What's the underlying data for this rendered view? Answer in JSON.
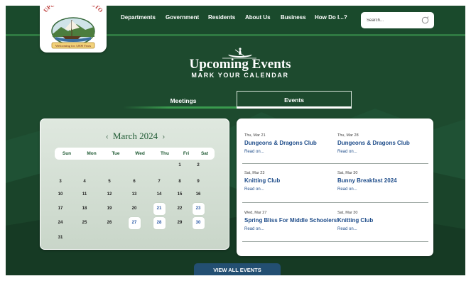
{
  "logo": {
    "name_top": "DUPONT · WASHINGTON",
    "banner": "Welcoming for 3,000 Years"
  },
  "nav": {
    "items": [
      "Departments",
      "Government",
      "Residents",
      "About Us",
      "Business",
      "How Do I...?"
    ]
  },
  "search": {
    "placeholder": "Search..."
  },
  "hero": {
    "title": "Upcoming Events",
    "subtitle": "MARK YOUR CALENDAR"
  },
  "tabs": {
    "meetings": "Meetings",
    "events": "Events",
    "active": "Events"
  },
  "calendar": {
    "month_label": "March 2024",
    "prev": "‹",
    "next": "›",
    "weekdays": [
      "Sun",
      "Mon",
      "Tue",
      "Wed",
      "Thu",
      "Fri",
      "Sat"
    ],
    "weeks": [
      [
        "",
        "",
        "",
        "",
        "",
        "1",
        "2"
      ],
      [
        "3",
        "4",
        "5",
        "6",
        "7",
        "8",
        "9"
      ],
      [
        "10",
        "11",
        "12",
        "13",
        "14",
        "15",
        "16"
      ],
      [
        "17",
        "18",
        "19",
        "20",
        "21",
        "22",
        "23"
      ],
      [
        "24",
        "25",
        "26",
        "27",
        "28",
        "29",
        "30"
      ],
      [
        "31",
        "",
        "",
        "",
        "",
        "",
        ""
      ]
    ],
    "event_days": [
      "21",
      "23",
      "27",
      "28",
      "30"
    ]
  },
  "events": [
    {
      "date": "Thu, Mar 21",
      "title": "Dungeons & Dragons Club",
      "read_more": "Read on..."
    },
    {
      "date": "Thu, Mar 28",
      "title": "Dungeons & Dragons Club",
      "read_more": "Read on..."
    },
    {
      "date": "Sat, Mar 23",
      "title": "Knitting Club",
      "read_more": "Read on..."
    },
    {
      "date": "Sat, Mar 30",
      "title": "Bunny Breakfast 2024",
      "read_more": "Read on..."
    },
    {
      "date": "Wed, Mar 27",
      "title": "Spring Bliss For Middle Schoolers!",
      "read_more": "Read on..."
    },
    {
      "date": "Sat, Mar 30",
      "title": "Knitting Club",
      "read_more": "Read on..."
    }
  ],
  "view_all": {
    "label": "VIEW ALL EVENTS"
  },
  "colors": {
    "page_green": "#1d4a2e",
    "accent_green": "#3a9a4e",
    "link_blue": "#1f4d8a",
    "button_blue": "#234f72"
  }
}
